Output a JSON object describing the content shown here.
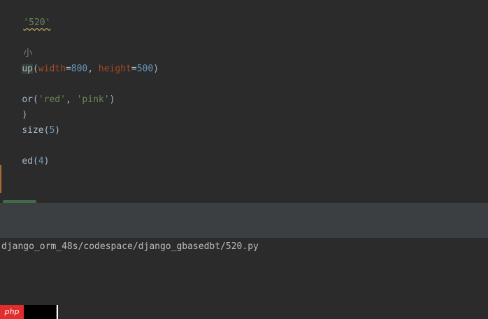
{
  "editor": {
    "line1": {
      "text": "'520'"
    },
    "line2": {
      "comment": "小"
    },
    "line3": {
      "fn": "up",
      "open": "(",
      "p1": "width",
      "eq1": "=",
      "v1": "800",
      "sep": ", ",
      "p2": "height",
      "eq2": "=",
      "v2": "500",
      "close": ")"
    },
    "line4": {
      "fn": "or(",
      "s1": "'red'",
      "sep": ", ",
      "s2": "'pink'",
      "close": ")"
    },
    "line5": {
      "text": ")"
    },
    "line6": {
      "fn": "size(",
      "num": "5",
      "close": ")"
    },
    "line7": {
      "fn": "ed(",
      "num": "4",
      "close": ")"
    }
  },
  "console": {
    "path": "django_orm_48s/codespace/django_gbasedbt/520.py"
  },
  "watermark": {
    "label": "php"
  },
  "colors": {
    "background": "#2b2b2b",
    "toolbar": "#3c3f41",
    "string": "#6a8759",
    "number": "#6897bb",
    "param": "#aa4926",
    "text": "#a9b7c6",
    "badge": "#e22d2d"
  }
}
